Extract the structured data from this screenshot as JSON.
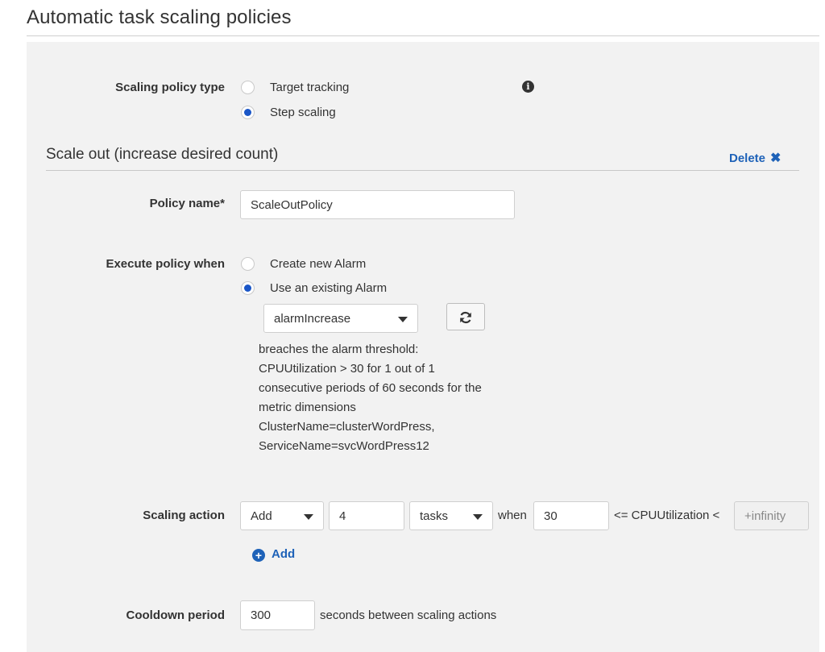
{
  "page": {
    "title": "Automatic task scaling policies"
  },
  "policy_type": {
    "label": "Scaling policy type",
    "options": [
      {
        "label": "Target tracking",
        "selected": false
      },
      {
        "label": "Step scaling",
        "selected": true
      }
    ],
    "info_icon": "info-icon"
  },
  "scale_out": {
    "heading": "Scale out (increase desired count)",
    "delete_label": "Delete",
    "delete_icon": "✖",
    "policy_name": {
      "label": "Policy name*",
      "value": "ScaleOutPolicy"
    },
    "execute_when": {
      "label": "Execute policy when",
      "options": [
        {
          "label": "Create new Alarm",
          "selected": false
        },
        {
          "label": "Use an existing Alarm",
          "selected": true
        }
      ],
      "alarm_select": "alarmIncrease",
      "refresh_icon": "refresh-icon",
      "description": [
        "breaches the alarm threshold:",
        "CPUUtilization > 30 for 1 out of 1",
        "consecutive periods of 60 seconds for the",
        "metric dimensions",
        "ClusterName=clusterWordPress,",
        "ServiceName=svcWordPress12"
      ]
    },
    "scaling_action": {
      "label": "Scaling action",
      "action": "Add",
      "amount": "4",
      "unit": "tasks",
      "when_text": "when",
      "lower_bound": "30",
      "metric_text": "<= CPUUtilization <",
      "upper_bound": "+infinity"
    },
    "add_step_label": "Add",
    "cooldown": {
      "label": "Cooldown period",
      "value": "300",
      "suffix": "seconds between scaling actions"
    }
  }
}
